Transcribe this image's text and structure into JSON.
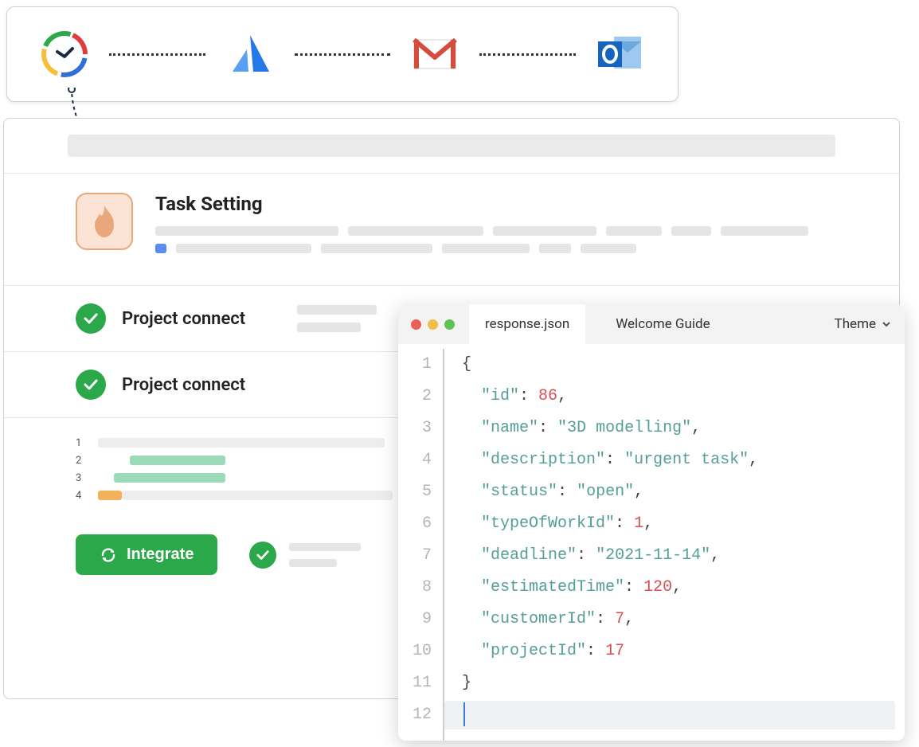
{
  "topApps": [
    "awork",
    "atlassian",
    "gmail",
    "outlook"
  ],
  "header": {
    "title": "Task Setting"
  },
  "rows": [
    {
      "label": "Project connect"
    },
    {
      "label": "Project connect"
    }
  ],
  "gantt": {
    "labels": [
      "1",
      "2",
      "3",
      "4"
    ]
  },
  "integrateButton": {
    "label": "Integrate"
  },
  "editor": {
    "tabs": [
      "response.json",
      "Welcome Guide"
    ],
    "activeTab": 0,
    "themeLabel": "Theme",
    "response": {
      "id": 86,
      "name": "3D modelling",
      "description": "urgent task",
      "status": "open",
      "typeOfWorkId": 1,
      "deadline": "2021-11-14",
      "estimatedTime": 120,
      "customerId": 7,
      "projectId": 17
    },
    "lineNumbers": [
      "1",
      "2",
      "3",
      "4",
      "5",
      "6",
      "7",
      "8",
      "9",
      "10",
      "11",
      "12"
    ]
  }
}
